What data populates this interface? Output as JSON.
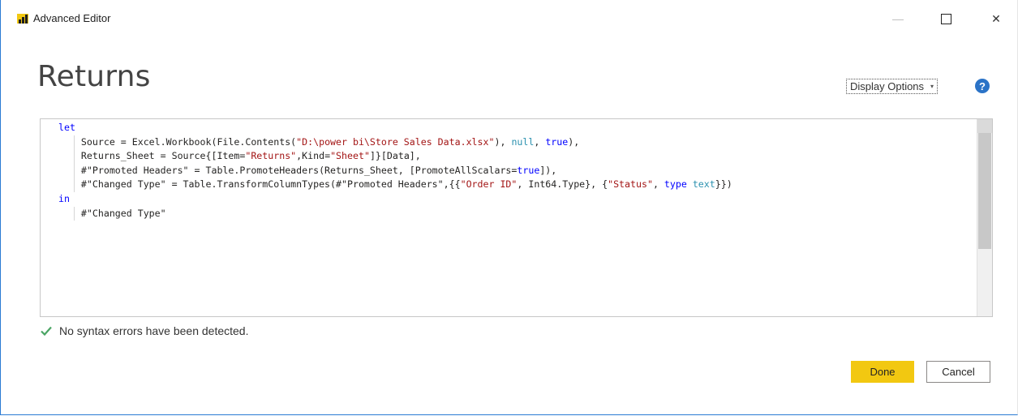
{
  "window": {
    "title": "Advanced Editor",
    "minimize_glyph": "—",
    "close_glyph": "✕"
  },
  "header": {
    "query_name": "Returns",
    "display_options_label": "Display Options",
    "display_options_caret": "▾",
    "help_glyph": "?"
  },
  "editor": {
    "lines": [
      [
        {
          "t": "let",
          "c": "kw"
        }
      ],
      [
        {
          "t": "    Source = Excel.Workbook(File.Contents(",
          "c": ""
        },
        {
          "t": "\"D:\\power bi\\Store Sales Data.xlsx\"",
          "c": "str"
        },
        {
          "t": "), ",
          "c": ""
        },
        {
          "t": "null",
          "c": "typ"
        },
        {
          "t": ", ",
          "c": ""
        },
        {
          "t": "true",
          "c": "kw"
        },
        {
          "t": "),",
          "c": ""
        }
      ],
      [
        {
          "t": "    Returns_Sheet = Source{[Item=",
          "c": ""
        },
        {
          "t": "\"Returns\"",
          "c": "str"
        },
        {
          "t": ",Kind=",
          "c": ""
        },
        {
          "t": "\"Sheet\"",
          "c": "str"
        },
        {
          "t": "]}[Data],",
          "c": ""
        }
      ],
      [
        {
          "t": "    #\"Promoted Headers\" = Table.PromoteHeaders(Returns_Sheet, [PromoteAllScalars=",
          "c": ""
        },
        {
          "t": "true",
          "c": "kw"
        },
        {
          "t": "]),",
          "c": ""
        }
      ],
      [
        {
          "t": "    #\"Changed Type\" = Table.TransformColumnTypes(#\"Promoted Headers\",{{",
          "c": ""
        },
        {
          "t": "\"Order ID\"",
          "c": "str"
        },
        {
          "t": ", Int64.Type}, {",
          "c": ""
        },
        {
          "t": "\"Status\"",
          "c": "str"
        },
        {
          "t": ", ",
          "c": ""
        },
        {
          "t": "type",
          "c": "kw"
        },
        {
          "t": " ",
          "c": ""
        },
        {
          "t": "text",
          "c": "typ"
        },
        {
          "t": "}})",
          "c": ""
        }
      ],
      [
        {
          "t": "in",
          "c": "kw"
        }
      ],
      [
        {
          "t": "    #\"Changed Type\"",
          "c": ""
        }
      ]
    ],
    "indent_guide_lines": [
      1,
      2,
      3,
      4,
      6
    ]
  },
  "status": {
    "message": "No syntax errors have been detected."
  },
  "footer": {
    "done_label": "Done",
    "cancel_label": "Cancel"
  },
  "colors": {
    "accent_yellow": "#f2c811",
    "keyword": "#0000ff",
    "string": "#a31515",
    "type": "#2b91af",
    "help_blue": "#2b73c7",
    "check_green": "#4aa564"
  }
}
